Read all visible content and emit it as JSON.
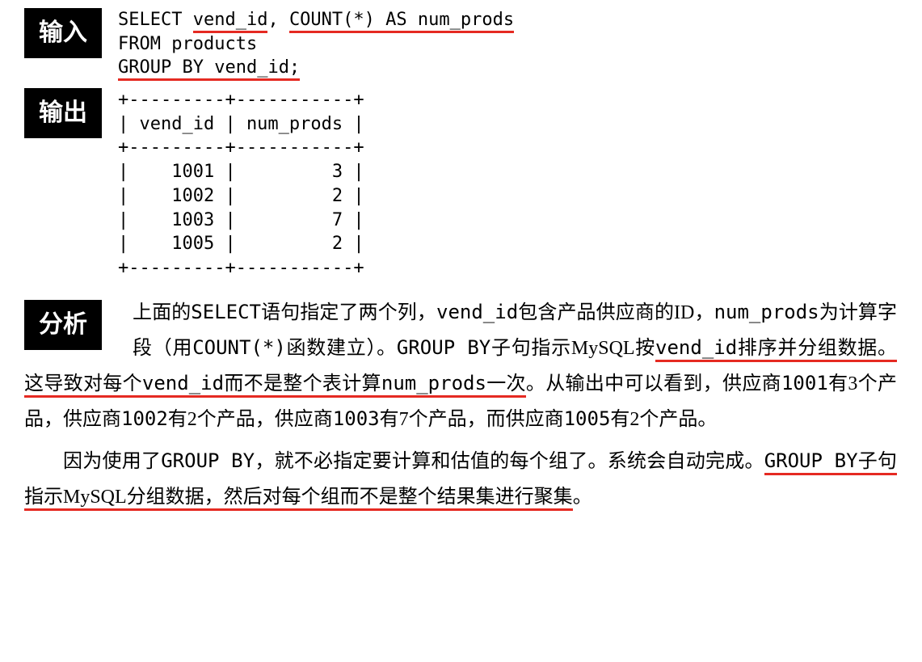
{
  "labels": {
    "input": "输入",
    "output": "输出",
    "analysis": "分析"
  },
  "sql": {
    "select": "SELECT ",
    "vend_id": "vend_id",
    "comma": ", ",
    "count_star": "COUNT(*) AS num_prods",
    "from": "FROM products",
    "groupby_pre": "GROUP BY ",
    "groupby_col": "vend_id;"
  },
  "output_table": "+---------+-----------+\n| vend_id | num_prods |\n+---------+-----------+\n|    1001 |         3 |\n|    1002 |         2 |\n|    1003 |         7 |\n|    1005 |         2 |\n+---------+-----------+",
  "chart_data": {
    "type": "table",
    "columns": [
      "vend_id",
      "num_prods"
    ],
    "rows": [
      [
        1001,
        3
      ],
      [
        1002,
        2
      ],
      [
        1003,
        7
      ],
      [
        1005,
        2
      ]
    ]
  },
  "analysis": {
    "p1_a": "上面的",
    "p1_b": "SELECT",
    "p1_c": "语句指定了两个列，",
    "p1_d": "vend_id",
    "p1_e": "包含产品供应商的ID，",
    "p1_f": "num_prods",
    "p1_g": "为计算字段（用",
    "p1_h": "COUNT(*)",
    "p1_i": "函数建立）。",
    "p1_j": "GROUP BY",
    "p1_k": "子句指示MySQL按",
    "p1_l": "vend_id",
    "p1_m": "排序并分组数据。这导致对每个",
    "p1_n": "vend_id",
    "p1_o": "而不是整个表计算",
    "p1_p": "num_prods",
    "p1_q": "一次",
    "p1_r": "。从输出中可以看到，供应商",
    "p1_s": "1001",
    "p1_t": "有3个产品，供应商",
    "p1_u": "1002",
    "p1_v": "有2个产品，供应商",
    "p1_w": "1003",
    "p1_x": "有7个产品，而供应商",
    "p1_y": "1005",
    "p1_z": "有2个产品。",
    "p2_a": "因为使用了",
    "p2_b": "GROUP BY",
    "p2_c": "，就不必指定要计算和估值的每个组了。系统会自动完成。",
    "p2_d": "GROUP BY",
    "p2_e": "子句指示MySQL分组数据，然后对每个组而不是整个结果集进行聚集",
    "p2_f": "。"
  }
}
